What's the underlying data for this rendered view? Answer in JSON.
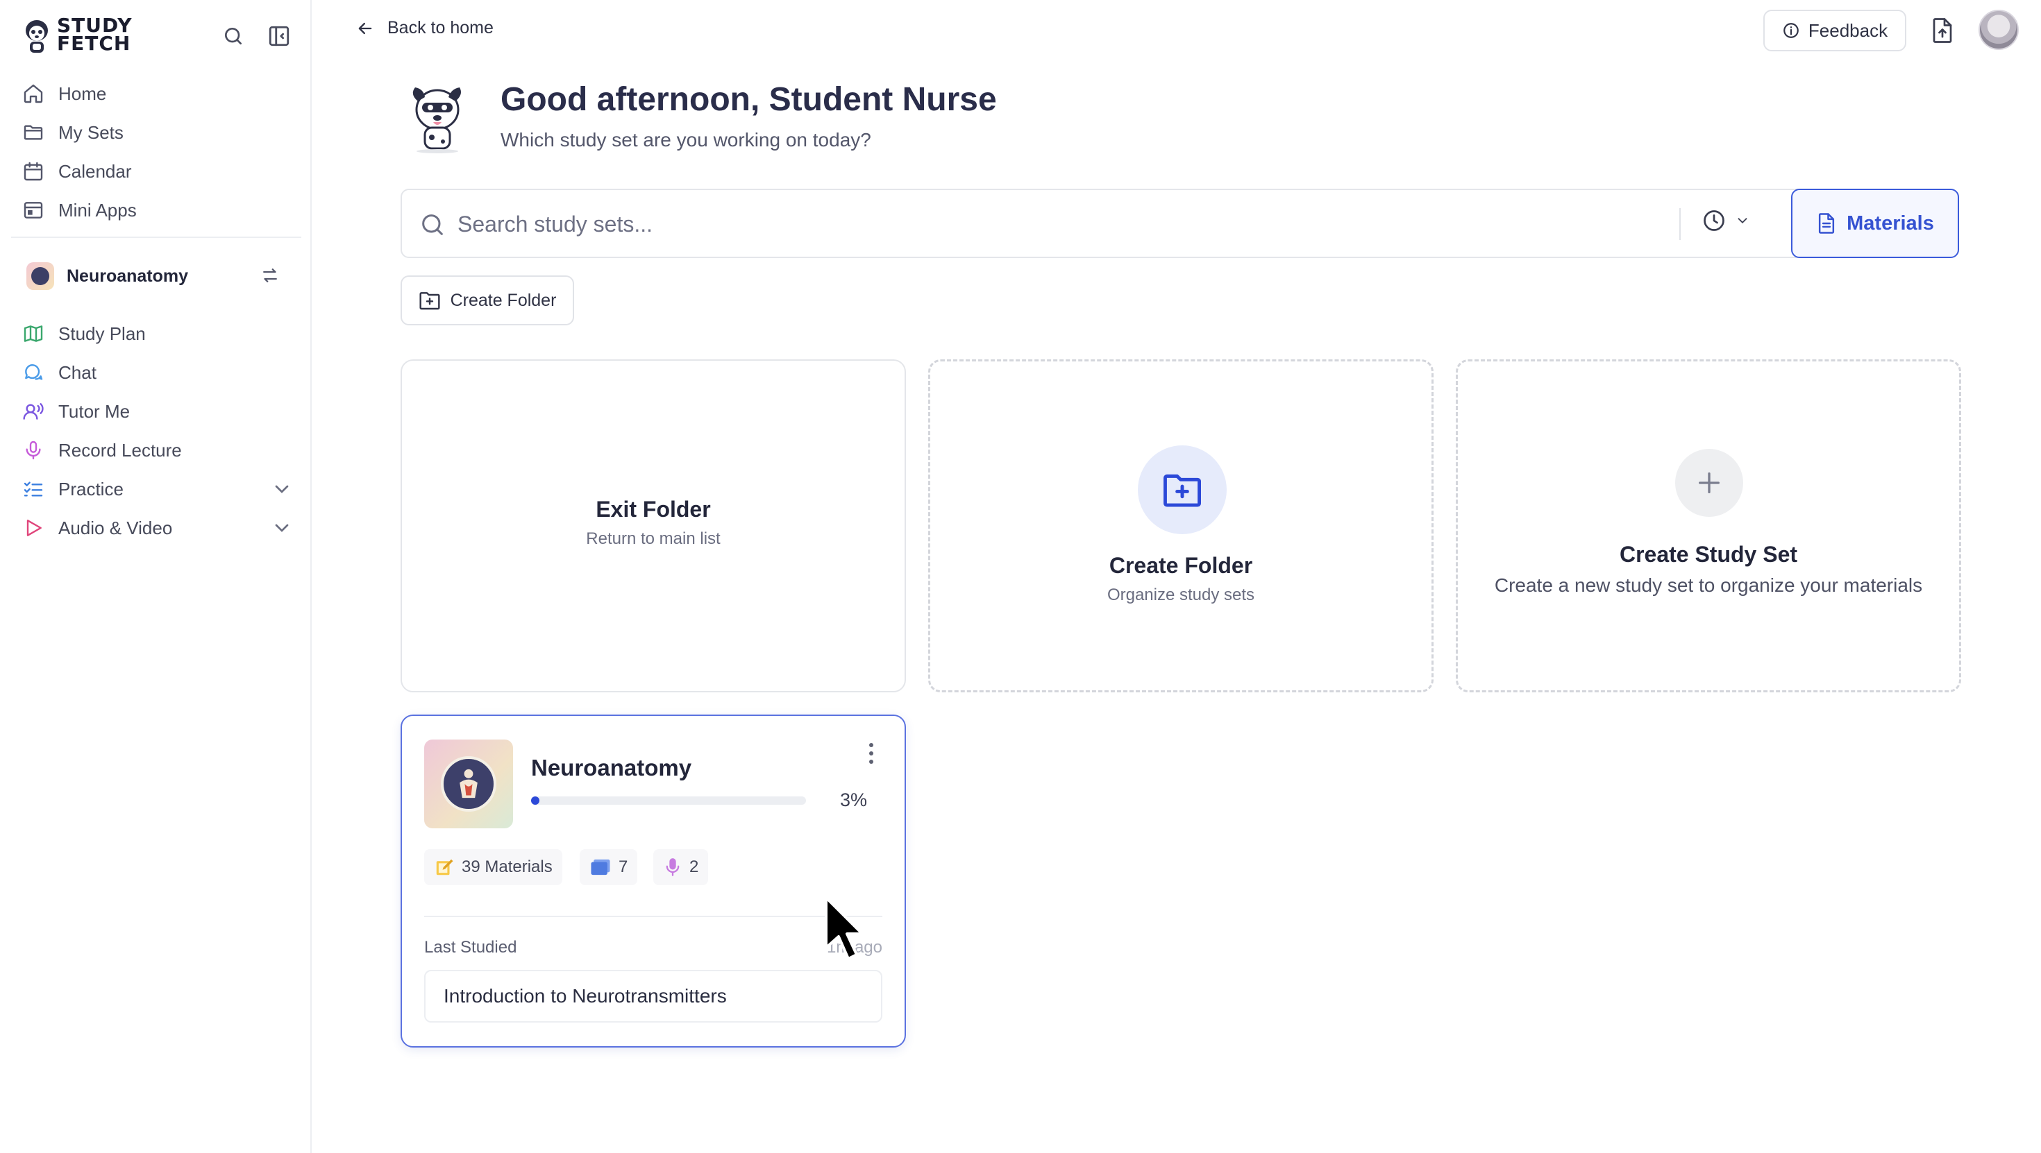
{
  "brand": {
    "line1": "STUDY",
    "line2": "FETCH"
  },
  "sidebar": {
    "nav": [
      {
        "label": "Home",
        "icon": "home-icon"
      },
      {
        "label": "My Sets",
        "icon": "folder-icon"
      },
      {
        "label": "Calendar",
        "icon": "calendar-icon"
      },
      {
        "label": "Mini Apps",
        "icon": "app-window-icon"
      }
    ],
    "current_set": {
      "name": "Neuroanatomy"
    },
    "tools": [
      {
        "label": "Study Plan",
        "icon": "map-icon",
        "color": "#3aa76d"
      },
      {
        "label": "Chat",
        "icon": "chat-icon",
        "color": "#4a9be8"
      },
      {
        "label": "Tutor Me",
        "icon": "tutor-icon",
        "color": "#7a56e0"
      },
      {
        "label": "Record Lecture",
        "icon": "microphone-icon",
        "color": "#c65bd9"
      },
      {
        "label": "Practice",
        "icon": "checklist-icon",
        "color": "#3b7fe0"
      },
      {
        "label": "Audio & Video",
        "icon": "play-icon",
        "color": "#e0457b"
      }
    ]
  },
  "topbar": {
    "back_label": "Back to home",
    "feedback_label": "Feedback"
  },
  "greeting": {
    "title": "Good afternoon, Student Nurse",
    "subtitle": "Which study set are you working on today?"
  },
  "search": {
    "placeholder": "Search study sets...",
    "materials_label": "Materials"
  },
  "create_folder_button": "Create Folder",
  "cards": {
    "exit_folder": {
      "title": "Exit Folder",
      "subtitle": "Return to main list"
    },
    "create_folder": {
      "title": "Create Folder",
      "subtitle": "Organize study sets"
    },
    "create_set": {
      "title": "Create Study Set",
      "subtitle": "Create a new study set to organize your materials"
    }
  },
  "study_set": {
    "title": "Neuroanatomy",
    "progress_label": "3%",
    "progress_fraction": 0.03,
    "materials": "39 Materials",
    "flashcard_sets": "7",
    "recordings": "2",
    "last_studied_label": "Last Studied",
    "last_studied_time": "1m ago",
    "last_topic": "Introduction to Neurotransmitters"
  },
  "colors": {
    "accent": "#3b5bdb",
    "progress": "#2c49d8"
  }
}
